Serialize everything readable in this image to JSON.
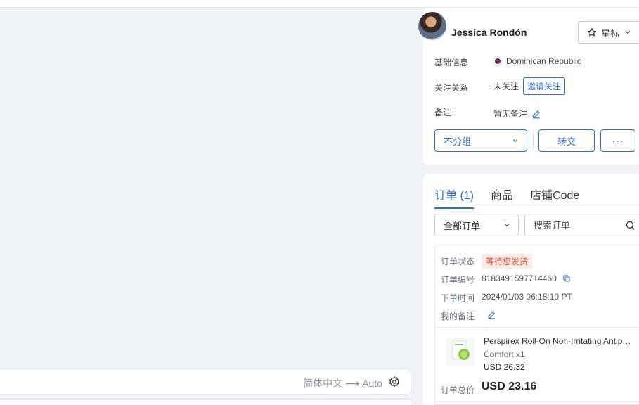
{
  "translate": {
    "source_lang": "简体中文",
    "arrow": "⟶",
    "target_lang": "Auto"
  },
  "profile": {
    "name": "Jessica Rondón",
    "star_label": "星标",
    "basic_info_label": "基础信息",
    "country": "Dominican Republic",
    "follow_label": "关注关系",
    "follow_status": "未关注",
    "invite_label": "邀请关注",
    "note_label": "备注",
    "note_value": "暂无备注",
    "group_value": "不分组",
    "transfer_label": "转交",
    "more_label": "···"
  },
  "orders": {
    "tabs": [
      {
        "label": "订单 (1)",
        "active": true
      },
      {
        "label": "商品",
        "active": false
      },
      {
        "label": "店铺Code",
        "active": false
      }
    ],
    "filter_value": "全部订单",
    "search_placeholder": "搜索订单",
    "status_label": "订单状态",
    "status_value": "等待您发货",
    "order_no_label": "订单编号",
    "order_no": "8183491597714460",
    "time_label": "下单时间",
    "time_value": "2024/01/03 06:18:10 PT",
    "my_note_label": "我的备注",
    "product_title": "Perspirex Roll-On Non-Irritating Antiperspirant",
    "product_variant": "Comfort x1",
    "product_price": "USD 26.32",
    "total_label": "订单总价",
    "total_value": "USD 23.16"
  },
  "colors": {
    "accent": "#2f6ccc",
    "status": "#e0522d",
    "background": "#f1f2f5"
  }
}
